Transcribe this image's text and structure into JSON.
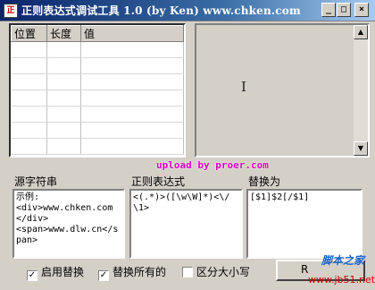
{
  "window": {
    "app_icon": "regex-app-icon",
    "title": "正则表达式调试工具 1.0 (by Ken) www.chken.com",
    "controls": {
      "minimize": "_",
      "maximize": "□",
      "close": "×"
    }
  },
  "results": {
    "columns": [
      "位置",
      "长度",
      "值"
    ],
    "rows": []
  },
  "preview": {
    "cursor": "I"
  },
  "labels": {
    "source": "源字符串",
    "regex": "正则表达式",
    "replace": "替换为"
  },
  "watermark": "upload by proer.com",
  "inputs": {
    "source": "示例:\n<div>www.chken.com</div>\n<span>www.dlw.cn</span>",
    "regex": "<(.*)>([\\w\\W]*)<\\/\\1>",
    "replace": "[$1]$2[/$1]"
  },
  "options": {
    "enable_replace": {
      "label": "启用替换",
      "checked": true
    },
    "replace_all": {
      "label": "替换所有的",
      "checked": true
    },
    "case_sensitive": {
      "label": "区分大小写",
      "checked": false
    }
  },
  "run_button": "R",
  "brand": {
    "logo": "脚本之家",
    "url": "www.jb51.net"
  }
}
